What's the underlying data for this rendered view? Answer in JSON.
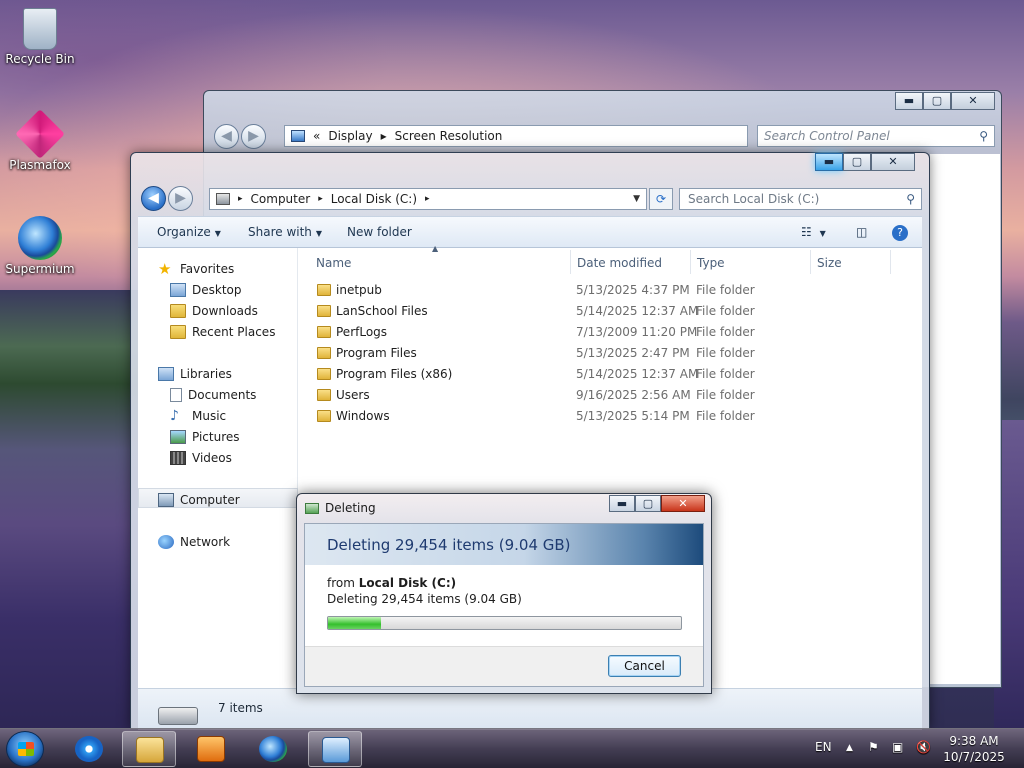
{
  "desktop": {
    "icons": [
      {
        "label": "Recycle Bin",
        "icon": "recycle-bin-icon"
      },
      {
        "label": "Plasmafox",
        "icon": "plasmafox-icon"
      },
      {
        "label": "Supermium",
        "icon": "supermium-icon"
      }
    ]
  },
  "back_window": {
    "breadcrumb": [
      "«",
      "Display",
      "▸",
      "Screen Resolution"
    ],
    "search_placeholder": "Search Control Panel"
  },
  "explorer": {
    "breadcrumb": [
      "Computer",
      "▸",
      "Local Disk (C:)",
      "▸"
    ],
    "search_placeholder": "Search Local Disk (C:)",
    "toolbar": {
      "organize": "Organize",
      "share": "Share with",
      "new_folder": "New folder"
    },
    "sidebar": {
      "favorites": "Favorites",
      "desktop": "Desktop",
      "downloads": "Downloads",
      "recent": "Recent Places",
      "libraries": "Libraries",
      "documents": "Documents",
      "music": "Music",
      "pictures": "Pictures",
      "videos": "Videos",
      "computer": "Computer",
      "network": "Network"
    },
    "columns": {
      "name": "Name",
      "date": "Date modified",
      "type": "Type",
      "size": "Size"
    },
    "rows": [
      {
        "name": "inetpub",
        "date": "5/13/2025 4:37 PM",
        "type": "File folder"
      },
      {
        "name": "LanSchool Files",
        "date": "5/14/2025 12:37 AM",
        "type": "File folder"
      },
      {
        "name": "PerfLogs",
        "date": "7/13/2009 11:20 PM",
        "type": "File folder"
      },
      {
        "name": "Program Files",
        "date": "5/13/2025 2:47 PM",
        "type": "File folder"
      },
      {
        "name": "Program Files (x86)",
        "date": "5/14/2025 12:37 AM",
        "type": "File folder"
      },
      {
        "name": "Users",
        "date": "9/16/2025 2:56 AM",
        "type": "File folder"
      },
      {
        "name": "Windows",
        "date": "5/13/2025 5:14 PM",
        "type": "File folder"
      }
    ],
    "status": "7 items"
  },
  "dialog": {
    "title": "Deleting",
    "header": "Deleting 29,454 items (9.04 GB)",
    "from_label": "from",
    "from_value": "Local Disk (C:)",
    "detail": "Deleting 29,454 items (9.04 GB)",
    "progress": 0.15,
    "cancel": "Cancel"
  },
  "taskbar": {
    "language": "EN",
    "time": "9:38 AM",
    "date": "10/7/2025"
  }
}
